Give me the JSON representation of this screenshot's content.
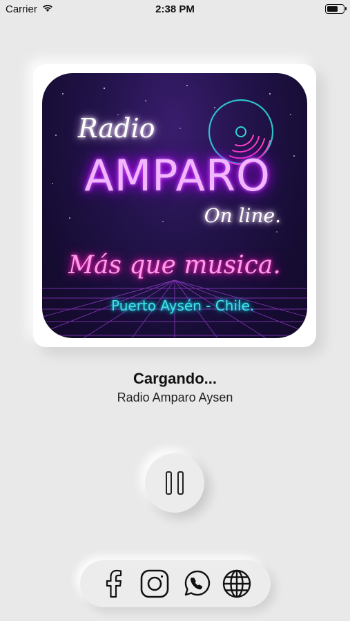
{
  "status_bar": {
    "carrier": "Carrier",
    "time": "2:38 PM",
    "battery_level": 0.7
  },
  "artwork": {
    "line1": "Radio",
    "line2": "AMPARO",
    "line3": "On line.",
    "tagline": "Más que musica.",
    "location": "Puerto Aysén - Chile.",
    "colors": {
      "amparo": "#f2b6ff",
      "tagline": "#ff9be6",
      "location": "#48e0e5",
      "background": "#1a0f3d"
    }
  },
  "player": {
    "title": "Cargando...",
    "station": "Radio Amparo Aysen",
    "control_icon": "pause-icon"
  },
  "social": [
    {
      "name": "facebook",
      "icon": "facebook-icon"
    },
    {
      "name": "instagram",
      "icon": "instagram-icon"
    },
    {
      "name": "whatsapp",
      "icon": "whatsapp-icon"
    },
    {
      "name": "website",
      "icon": "globe-icon"
    }
  ]
}
